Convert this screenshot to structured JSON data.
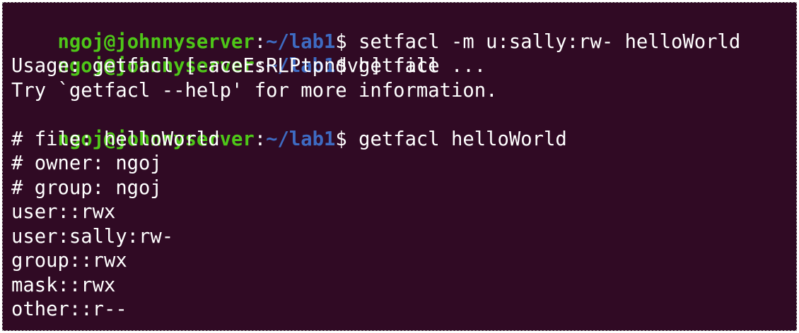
{
  "colors": {
    "background": "#300a24",
    "prompt_user_host": "#4ec718",
    "prompt_path": "#3e6bc2",
    "text": "#ffffff"
  },
  "prompt": {
    "user_host": "ngoj@johnnyserver",
    "colon": ":",
    "path": "~/lab1",
    "dollar": "$ "
  },
  "lines": [
    {
      "type": "command",
      "command": "setfacl -m u:sally:rw- helloWorld"
    },
    {
      "type": "command",
      "command": "getfacl"
    },
    {
      "type": "output",
      "text": "Usage: getfacl [-aceEsRLPtpndvh] file ..."
    },
    {
      "type": "output",
      "text": "Try `getfacl --help' for more information."
    },
    {
      "type": "command",
      "command": "getfacl helloWorld"
    },
    {
      "type": "output",
      "text": "# file: helloWorld"
    },
    {
      "type": "output",
      "text": "# owner: ngoj"
    },
    {
      "type": "output",
      "text": "# group: ngoj"
    },
    {
      "type": "output",
      "text": "user::rwx"
    },
    {
      "type": "output",
      "text": "user:sally:rw-"
    },
    {
      "type": "output",
      "text": "group::rwx"
    },
    {
      "type": "output",
      "text": "mask::rwx"
    },
    {
      "type": "output",
      "text": "other::r--"
    }
  ]
}
